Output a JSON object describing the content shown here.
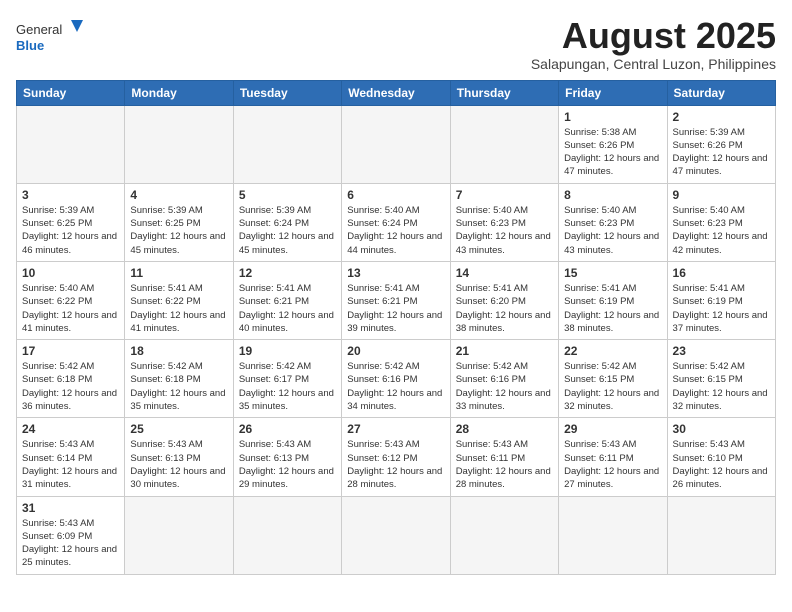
{
  "header": {
    "logo_general": "General",
    "logo_blue": "Blue",
    "title": "August 2025",
    "subtitle": "Salapungan, Central Luzon, Philippines"
  },
  "days_of_week": [
    "Sunday",
    "Monday",
    "Tuesday",
    "Wednesday",
    "Thursday",
    "Friday",
    "Saturday"
  ],
  "weeks": [
    [
      {
        "day": "",
        "info": ""
      },
      {
        "day": "",
        "info": ""
      },
      {
        "day": "",
        "info": ""
      },
      {
        "day": "",
        "info": ""
      },
      {
        "day": "",
        "info": ""
      },
      {
        "day": "1",
        "info": "Sunrise: 5:38 AM\nSunset: 6:26 PM\nDaylight: 12 hours and 47 minutes."
      },
      {
        "day": "2",
        "info": "Sunrise: 5:39 AM\nSunset: 6:26 PM\nDaylight: 12 hours and 47 minutes."
      }
    ],
    [
      {
        "day": "3",
        "info": "Sunrise: 5:39 AM\nSunset: 6:25 PM\nDaylight: 12 hours and 46 minutes."
      },
      {
        "day": "4",
        "info": "Sunrise: 5:39 AM\nSunset: 6:25 PM\nDaylight: 12 hours and 45 minutes."
      },
      {
        "day": "5",
        "info": "Sunrise: 5:39 AM\nSunset: 6:24 PM\nDaylight: 12 hours and 45 minutes."
      },
      {
        "day": "6",
        "info": "Sunrise: 5:40 AM\nSunset: 6:24 PM\nDaylight: 12 hours and 44 minutes."
      },
      {
        "day": "7",
        "info": "Sunrise: 5:40 AM\nSunset: 6:23 PM\nDaylight: 12 hours and 43 minutes."
      },
      {
        "day": "8",
        "info": "Sunrise: 5:40 AM\nSunset: 6:23 PM\nDaylight: 12 hours and 43 minutes."
      },
      {
        "day": "9",
        "info": "Sunrise: 5:40 AM\nSunset: 6:23 PM\nDaylight: 12 hours and 42 minutes."
      }
    ],
    [
      {
        "day": "10",
        "info": "Sunrise: 5:40 AM\nSunset: 6:22 PM\nDaylight: 12 hours and 41 minutes."
      },
      {
        "day": "11",
        "info": "Sunrise: 5:41 AM\nSunset: 6:22 PM\nDaylight: 12 hours and 41 minutes."
      },
      {
        "day": "12",
        "info": "Sunrise: 5:41 AM\nSunset: 6:21 PM\nDaylight: 12 hours and 40 minutes."
      },
      {
        "day": "13",
        "info": "Sunrise: 5:41 AM\nSunset: 6:21 PM\nDaylight: 12 hours and 39 minutes."
      },
      {
        "day": "14",
        "info": "Sunrise: 5:41 AM\nSunset: 6:20 PM\nDaylight: 12 hours and 38 minutes."
      },
      {
        "day": "15",
        "info": "Sunrise: 5:41 AM\nSunset: 6:19 PM\nDaylight: 12 hours and 38 minutes."
      },
      {
        "day": "16",
        "info": "Sunrise: 5:41 AM\nSunset: 6:19 PM\nDaylight: 12 hours and 37 minutes."
      }
    ],
    [
      {
        "day": "17",
        "info": "Sunrise: 5:42 AM\nSunset: 6:18 PM\nDaylight: 12 hours and 36 minutes."
      },
      {
        "day": "18",
        "info": "Sunrise: 5:42 AM\nSunset: 6:18 PM\nDaylight: 12 hours and 35 minutes."
      },
      {
        "day": "19",
        "info": "Sunrise: 5:42 AM\nSunset: 6:17 PM\nDaylight: 12 hours and 35 minutes."
      },
      {
        "day": "20",
        "info": "Sunrise: 5:42 AM\nSunset: 6:16 PM\nDaylight: 12 hours and 34 minutes."
      },
      {
        "day": "21",
        "info": "Sunrise: 5:42 AM\nSunset: 6:16 PM\nDaylight: 12 hours and 33 minutes."
      },
      {
        "day": "22",
        "info": "Sunrise: 5:42 AM\nSunset: 6:15 PM\nDaylight: 12 hours and 32 minutes."
      },
      {
        "day": "23",
        "info": "Sunrise: 5:42 AM\nSunset: 6:15 PM\nDaylight: 12 hours and 32 minutes."
      }
    ],
    [
      {
        "day": "24",
        "info": "Sunrise: 5:43 AM\nSunset: 6:14 PM\nDaylight: 12 hours and 31 minutes."
      },
      {
        "day": "25",
        "info": "Sunrise: 5:43 AM\nSunset: 6:13 PM\nDaylight: 12 hours and 30 minutes."
      },
      {
        "day": "26",
        "info": "Sunrise: 5:43 AM\nSunset: 6:13 PM\nDaylight: 12 hours and 29 minutes."
      },
      {
        "day": "27",
        "info": "Sunrise: 5:43 AM\nSunset: 6:12 PM\nDaylight: 12 hours and 28 minutes."
      },
      {
        "day": "28",
        "info": "Sunrise: 5:43 AM\nSunset: 6:11 PM\nDaylight: 12 hours and 28 minutes."
      },
      {
        "day": "29",
        "info": "Sunrise: 5:43 AM\nSunset: 6:11 PM\nDaylight: 12 hours and 27 minutes."
      },
      {
        "day": "30",
        "info": "Sunrise: 5:43 AM\nSunset: 6:10 PM\nDaylight: 12 hours and 26 minutes."
      }
    ],
    [
      {
        "day": "31",
        "info": "Sunrise: 5:43 AM\nSunset: 6:09 PM\nDaylight: 12 hours and 25 minutes."
      },
      {
        "day": "",
        "info": ""
      },
      {
        "day": "",
        "info": ""
      },
      {
        "day": "",
        "info": ""
      },
      {
        "day": "",
        "info": ""
      },
      {
        "day": "",
        "info": ""
      },
      {
        "day": "",
        "info": ""
      }
    ]
  ]
}
